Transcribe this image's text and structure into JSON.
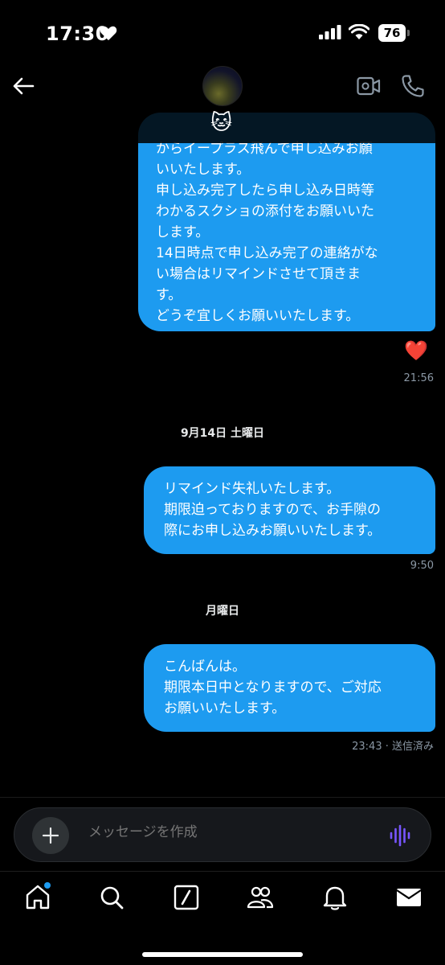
{
  "status_bar": {
    "time": "17:30",
    "battery": "76"
  },
  "header": {
    "name_emoji": "🐱"
  },
  "messages": [
    {
      "text": "からイープラス飛んで申し込みお願\nいいたします。\n申し込み完了したら申し込み日時等\nわかるスクショの添付をお願いいた\nします。\n14日時点で申し込み完了の連絡がな\nい場合はリマインドさせて頂きま\nす。\nどうぞ宜しくお願いいたします。",
      "timestamp": "21:56",
      "reaction": "❤️"
    },
    {
      "text": "リマインド失礼いたします。\n期限迫っておりますので、お手隙の\n際にお申し込みお願いいたします。",
      "timestamp": "9:50"
    },
    {
      "text": "こんばんは。\n期限本日中となりますので、ご対応\nお願いいたします。",
      "timestamp": "23:43 · 送信済み"
    }
  ],
  "dates": [
    "9月14日 土曜日",
    "月曜日"
  ],
  "composer": {
    "placeholder": "メッセージを作成"
  },
  "colors": {
    "bubble": "#1d9bf0",
    "accent": "#1d9bf0",
    "voice": "#7856ff"
  },
  "icons": [
    "back-arrow-icon",
    "video-call-icon",
    "phone-icon",
    "plus-icon",
    "voice-icon",
    "home-icon",
    "search-icon",
    "compose-icon",
    "people-icon",
    "bell-icon",
    "mail-icon"
  ]
}
